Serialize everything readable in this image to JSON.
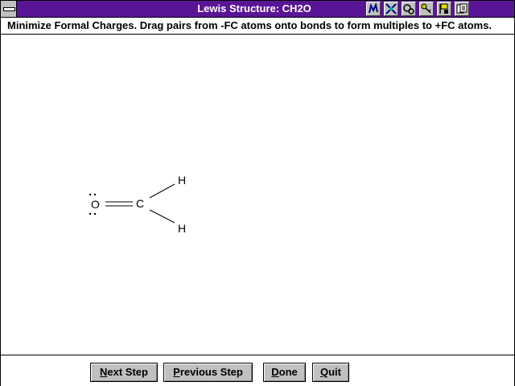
{
  "window": {
    "title": "Lewis Structure: CH2O"
  },
  "toolbar": {
    "icons": [
      "pencil-icon",
      "crossed-tools-icon",
      "gears-icon",
      "key-icon",
      "flag-icon",
      "pages-icon"
    ]
  },
  "instruction": "Minimize Formal Charges. Drag pairs from -FC atoms onto bonds to form multiples to +FC atoms.",
  "molecule": {
    "atoms": {
      "O": "O",
      "C": "C",
      "H1": "H",
      "H2": "H"
    },
    "lone_pairs_on_O": 2,
    "bonds": [
      {
        "from": "O",
        "to": "C",
        "order": 2
      },
      {
        "from": "C",
        "to": "H1",
        "order": 1
      },
      {
        "from": "C",
        "to": "H2",
        "order": 1
      }
    ]
  },
  "buttons": {
    "next_first": "N",
    "next_rest": "ext Step",
    "prev_first": "P",
    "prev_rest": "revious Step",
    "done_first": "D",
    "done_rest": "one",
    "quit_first": "Q",
    "quit_rest": "uit"
  }
}
